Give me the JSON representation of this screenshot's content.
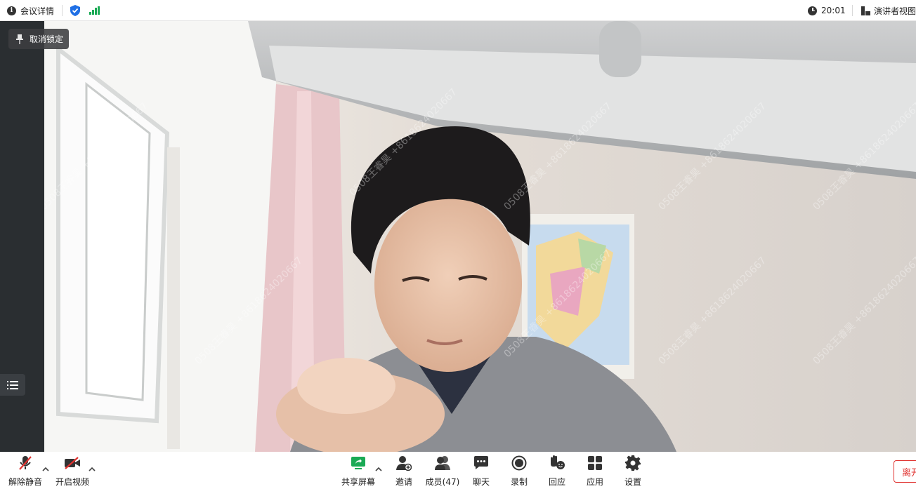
{
  "topbar": {
    "meeting_details": "会议详情",
    "time": "20:01",
    "view_mode": "演讲者视图"
  },
  "video": {
    "pin_label": "取消锁定",
    "watermark": "0508王睿昊 +8618624020667"
  },
  "toolbar": {
    "unmute": "解除静音",
    "start_video": "开启视频",
    "share_screen": "共享屏幕",
    "invite": "邀请",
    "participants": "成员(47)",
    "chat": "聊天",
    "record": "录制",
    "reactions": "回应",
    "apps": "应用",
    "settings": "设置",
    "leave": "离开"
  },
  "colors": {
    "accent_green": "#1aaa55",
    "shield_blue": "#1f6fe5",
    "leave_red": "#e0322f",
    "mute_red": "#e0322f"
  }
}
